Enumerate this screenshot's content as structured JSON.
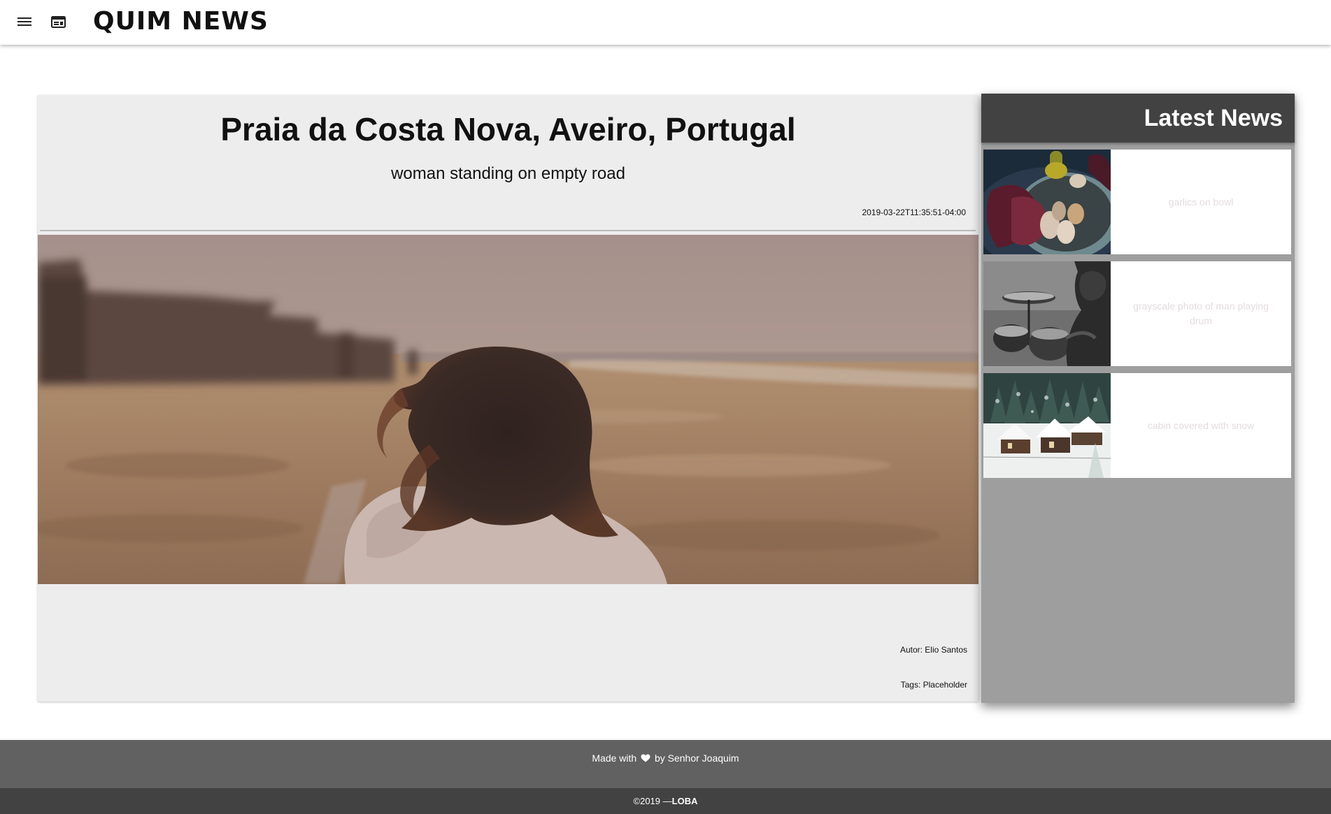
{
  "header": {
    "logo": "QUIM NEWS",
    "icons": [
      "menu-icon",
      "web-icon"
    ]
  },
  "article": {
    "title": "Praia da Costa Nova, Aveiro, Portugal",
    "subtitle": "woman standing on empty road",
    "date": "2019-03-22T11:35:51-04:00",
    "author": "Autor: Elio Santos",
    "tags": "Tags: Placeholder"
  },
  "sidebar": {
    "title": "Latest News",
    "items": [
      {
        "caption": "garlics on bowl"
      },
      {
        "caption": "grayscale photo of man playing drum"
      },
      {
        "caption": "cabin covered with snow"
      }
    ]
  },
  "footer": {
    "made_prefix": "Made with",
    "made_suffix": "by Senhor Joaquim",
    "copy_prefix": "©2019 —",
    "copy_brand": "LOBA"
  },
  "colors": {
    "topbar": "#ffffff",
    "card": "#eeeded",
    "sidebar": "#9e9e9e",
    "sidebar_header": "#424242",
    "footer_top": "#616161",
    "footer_bottom": "#424242"
  }
}
